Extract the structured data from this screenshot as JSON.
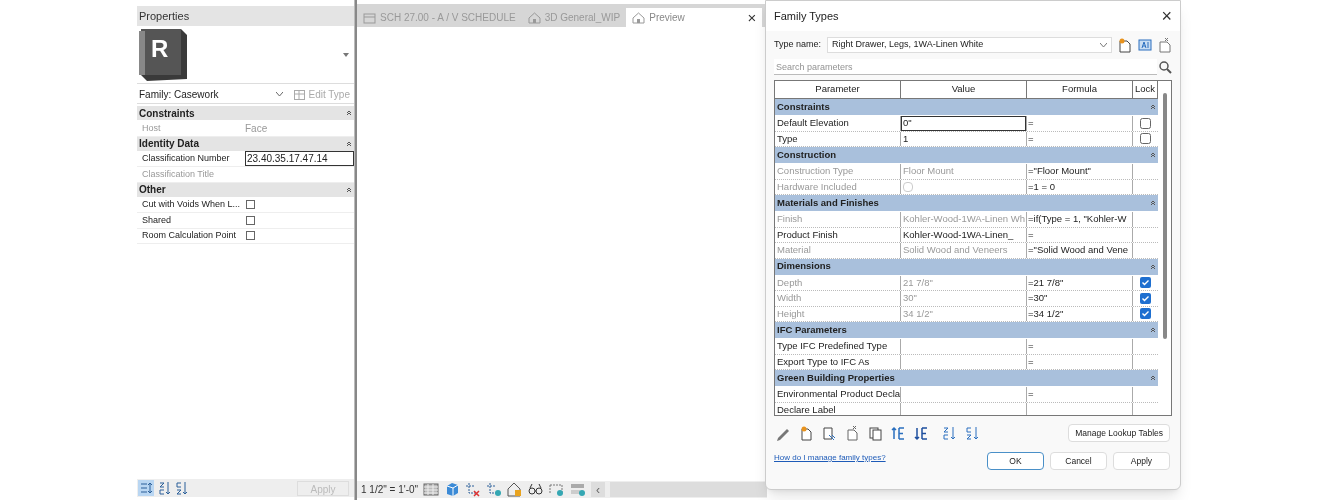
{
  "properties": {
    "title": "Properties",
    "logo": "R",
    "family": "Family: Casework",
    "edit_type": "Edit Type",
    "groups": [
      {
        "name": "Constraints",
        "rows": [
          {
            "kind": "text",
            "label": "Host",
            "value": "Face",
            "disabled": true
          }
        ]
      },
      {
        "name": "Identity Data",
        "rows": [
          {
            "kind": "field",
            "label": "Classification Number",
            "value": "23.40.35.17.47.14",
            "disabled": false
          },
          {
            "kind": "text",
            "label": "Classification Title",
            "disabled": true
          }
        ]
      },
      {
        "name": "Other",
        "rows": [
          {
            "kind": "checkbox",
            "label": "Cut with Voids When L...",
            "checked": false,
            "disabled": false
          },
          {
            "kind": "checkbox",
            "label": "Shared",
            "checked": false,
            "disabled": false
          },
          {
            "kind": "checkbox",
            "label": "Room Calculation Point",
            "checked": false,
            "disabled": false
          }
        ]
      }
    ],
    "apply": "Apply"
  },
  "view": {
    "tabs": [
      {
        "label": "SCH 27.00 - A / V SCHEDULE",
        "selected": false
      },
      {
        "label": "3D General_WIP",
        "selected": false
      },
      {
        "label": "Preview",
        "selected": true
      }
    ],
    "close": "×",
    "scale": "1 1/2\" = 1'-0\"",
    "scroll_left": "‹"
  },
  "dialog": {
    "title": "Family Types",
    "close": "×",
    "type_name_label": "Type name:",
    "type_name": "Right Drawer, Legs, 1WA-Linen White",
    "search": {
      "placeholder": "Search parameters"
    },
    "columns": [
      "Parameter",
      "Value",
      "Formula",
      "Lock"
    ],
    "groups": [
      {
        "name": "Constraints",
        "rows": [
          {
            "parameter": "Default Elevation",
            "value": "0\"",
            "formula": "=",
            "locked": false,
            "editing": true,
            "disabled": false
          },
          {
            "parameter": "Type",
            "value": "1",
            "formula": "=",
            "locked": false,
            "disabled": false
          }
        ]
      },
      {
        "name": "Construction",
        "rows": [
          {
            "parameter": "Construction Type",
            "value": "Floor Mount",
            "formula": "=\"Floor Mount\"",
            "disabled": true
          },
          {
            "parameter": "Hardware Included",
            "checked": false,
            "formula": "=1 = 0",
            "disabled": true
          }
        ]
      },
      {
        "name": "Materials and Finishes",
        "rows": [
          {
            "parameter": "Finish",
            "value": "Kohler-Wood-1WA-Linen Wh",
            "formula": "=if(Type = 1, \"Kohler-W",
            "disabled": true
          },
          {
            "parameter": "Product Finish",
            "value": "Kohler-Wood-1WA-Linen_",
            "formula": "=",
            "disabled": false
          },
          {
            "parameter": "Material",
            "value": "Solid Wood and Veneers",
            "formula": "=\"Solid Wood and Vene",
            "disabled": true
          }
        ]
      },
      {
        "name": "Dimensions",
        "rows": [
          {
            "parameter": "Depth",
            "value": "21 7/8\"",
            "formula": "=21 7/8\"",
            "locked": true,
            "disabled": true
          },
          {
            "parameter": "Width",
            "value": "30\"",
            "formula": "=30\"",
            "locked": true,
            "disabled": true
          },
          {
            "parameter": "Height",
            "value": "34 1/2\"",
            "formula": "=34 1/2\"",
            "locked": true,
            "disabled": true
          }
        ]
      },
      {
        "name": "IFC Parameters",
        "rows": [
          {
            "parameter": "Type IFC Predefined Type",
            "formula": "=",
            "disabled": false
          },
          {
            "parameter": "Export Type to IFC As",
            "formula": "=",
            "disabled": false
          }
        ]
      },
      {
        "name": "Green Building Properties",
        "rows": [
          {
            "parameter": "Environmental Product Decla",
            "formula": "=",
            "disabled": false
          },
          {
            "parameter": "Declare Label",
            "disabled": false
          }
        ]
      }
    ],
    "manage": "Manage Lookup Tables",
    "help_link": "How do I manage family types?",
    "buttons": [
      {
        "label": "OK",
        "default": true
      },
      {
        "label": "Cancel",
        "default": false
      },
      {
        "label": "Apply",
        "default": false
      }
    ]
  }
}
